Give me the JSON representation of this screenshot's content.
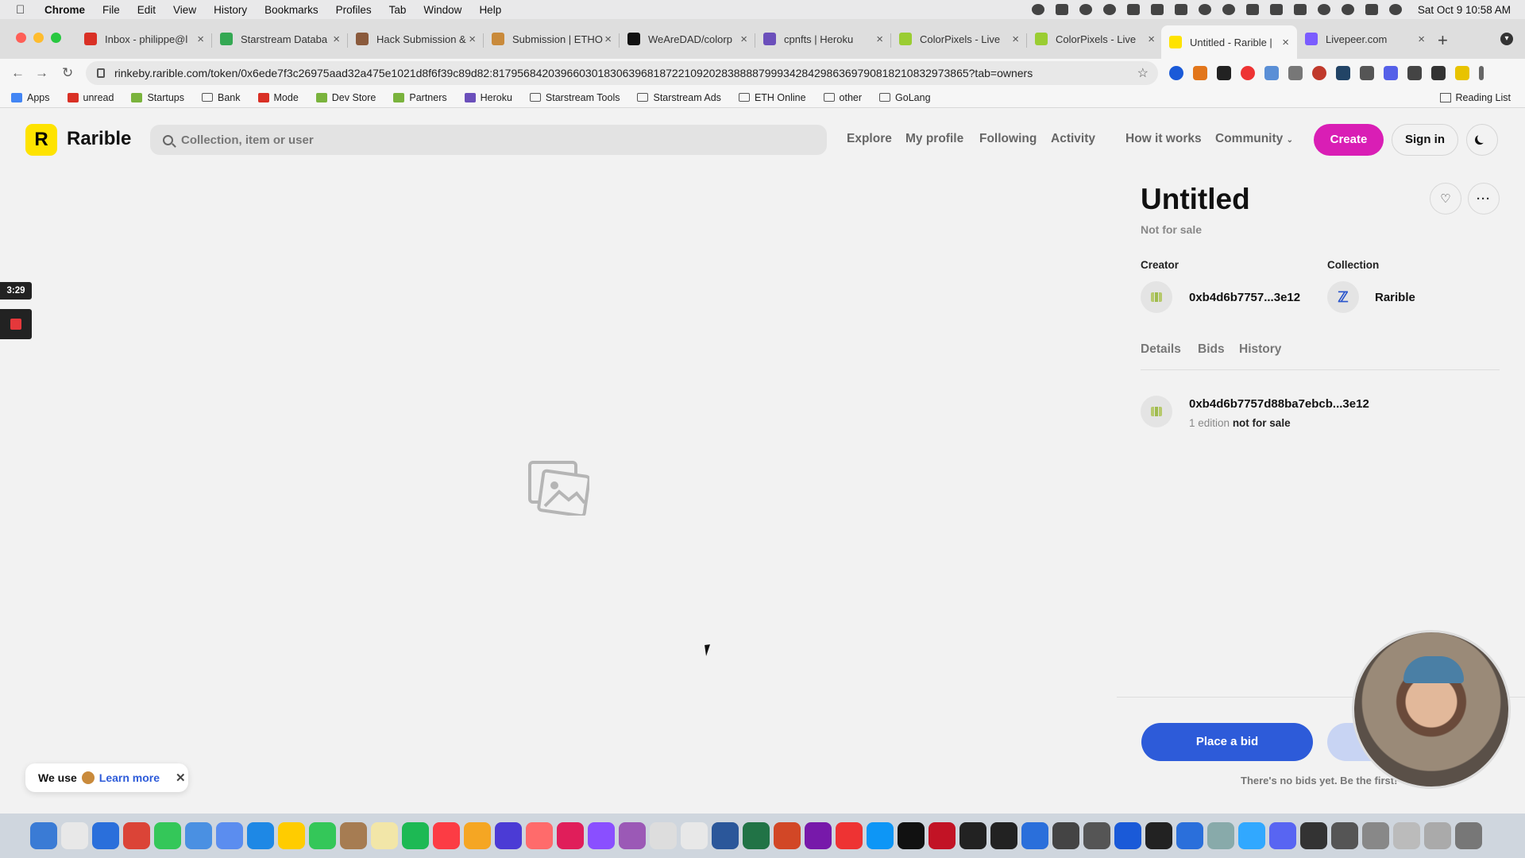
{
  "menubar": {
    "app": "Chrome",
    "items": [
      "File",
      "Edit",
      "View",
      "History",
      "Bookmarks",
      "Profiles",
      "Tab",
      "Window",
      "Help"
    ],
    "clock": "Sat Oct 9  10:58 AM"
  },
  "tabs": [
    {
      "label": "Inbox - philippe@l",
      "color": "#d93025"
    },
    {
      "label": "Starstream Databa",
      "color": "#34a853"
    },
    {
      "label": "Hack Submission &",
      "color": "#8a5a3c"
    },
    {
      "label": "Submission | ETHO",
      "color": "#c98a3b"
    },
    {
      "label": "WeAreDAD/colorp",
      "color": "#111111"
    },
    {
      "label": "cpnfts | Heroku",
      "color": "#6b4fbb"
    },
    {
      "label": "ColorPixels - Live",
      "color": "#9acd32"
    },
    {
      "label": "ColorPixels - Live",
      "color": "#9acd32"
    },
    {
      "label": "Untitled - Rarible |",
      "color": "#fee300"
    },
    {
      "label": "Livepeer.com",
      "color": "#7b5cff"
    }
  ],
  "address": {
    "url": "rinkeby.rarible.com/token/0x6ede7f3c26975aad32a475e1021d8f6f39c89d82:81795684203966030183063968187221092028388887999342842986369790818210832973865?tab=owners"
  },
  "bookmarks": [
    {
      "label": "Apps",
      "type": "apps"
    },
    {
      "label": "unread",
      "type": "gmail"
    },
    {
      "label": "Startups",
      "type": "shop"
    },
    {
      "label": "Bank",
      "type": "folder"
    },
    {
      "label": "Mode",
      "type": "gmail"
    },
    {
      "label": "Dev Store",
      "type": "shop"
    },
    {
      "label": "Partners",
      "type": "shop"
    },
    {
      "label": "Heroku",
      "type": "heroku"
    },
    {
      "label": "Starstream Tools",
      "type": "folder"
    },
    {
      "label": "Starstream Ads",
      "type": "folder"
    },
    {
      "label": "ETH Online",
      "type": "folder"
    },
    {
      "label": "other",
      "type": "folder"
    },
    {
      "label": "GoLang",
      "type": "folder"
    }
  ],
  "reading_list": "Reading List",
  "site": {
    "logo_letter": "R",
    "brand": "Rarible",
    "search_placeholder": "Collection, item or user",
    "nav": [
      "Explore",
      "My profile",
      "Following",
      "Activity",
      "How it works",
      "Community"
    ],
    "create": "Create",
    "sign_in": "Sign in"
  },
  "item": {
    "title": "Untitled",
    "sale_status": "Not for sale",
    "creator_label": "Creator",
    "creator": "0xb4d6b7757...3e12",
    "collection_label": "Collection",
    "collection": "Rarible",
    "tabs": [
      "Details",
      "Bids",
      "History"
    ],
    "owner": "0xb4d6b7757d88ba7ebcb...3e12",
    "owner_edition": "1 edition",
    "owner_status": "not for sale",
    "place_bid": "Place a bid",
    "no_bids": "There's no bids yet. Be the first!"
  },
  "cookie": {
    "prefix": "We use",
    "learn_more": "Learn more"
  },
  "recorder": {
    "time": "3:29"
  },
  "colors": {
    "create": "#d91eb5",
    "bid": "#2d5bd9",
    "logo": "#fee300"
  }
}
